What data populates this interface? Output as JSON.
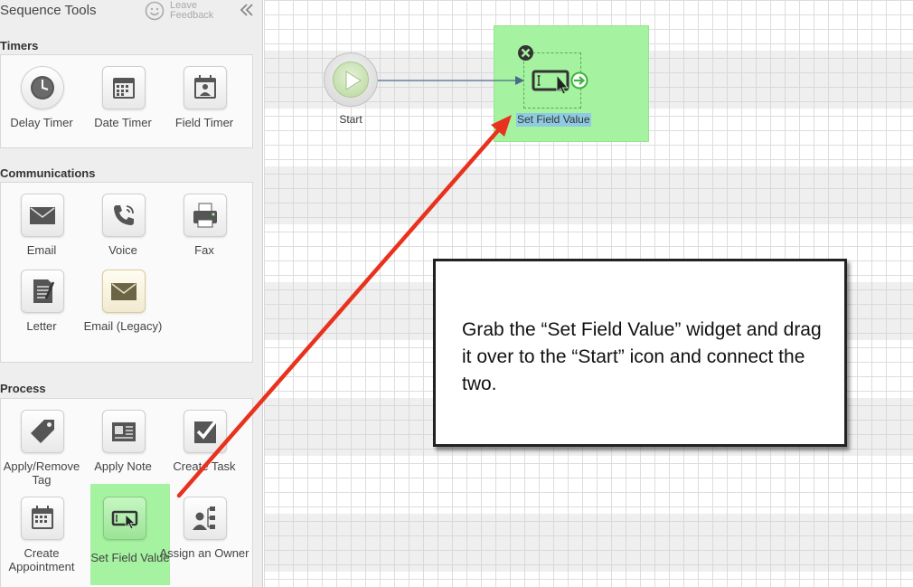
{
  "sidebar": {
    "title": "Sequence Tools",
    "feedback_label": "Leave Feedback",
    "sections": {
      "timers": {
        "title": "Timers",
        "items": [
          {
            "label": "Delay Timer",
            "icon": "clock-icon"
          },
          {
            "label": "Date Timer",
            "icon": "calendar-grid-icon"
          },
          {
            "label": "Field Timer",
            "icon": "calendar-person-icon"
          }
        ]
      },
      "communications": {
        "title": "Communications",
        "items": [
          {
            "label": "Email",
            "icon": "envelope-icon"
          },
          {
            "label": "Voice",
            "icon": "phone-icon"
          },
          {
            "label": "Fax",
            "icon": "fax-icon"
          },
          {
            "label": "Letter",
            "icon": "letter-icon"
          },
          {
            "label": "Email (Legacy)",
            "icon": "legacy-envelope-icon"
          }
        ]
      },
      "process": {
        "title": "Process",
        "items": [
          {
            "label": "Apply/Remove Tag",
            "icon": "tag-icon"
          },
          {
            "label": "Apply Note",
            "icon": "note-card-icon"
          },
          {
            "label": "Create Task",
            "icon": "checkbox-icon"
          },
          {
            "label": "Create Appointment",
            "icon": "appointment-icon"
          },
          {
            "label": "Set Field Value",
            "icon": "set-field-icon",
            "highlighted": true
          },
          {
            "label": "Assign an Owner",
            "icon": "owner-org-icon"
          }
        ]
      }
    }
  },
  "canvas": {
    "start_label": "Start",
    "node_label": "Set Field Value"
  },
  "callout": {
    "text": "Grab the “Set Field Value” widget and drag it over to the “Start” icon and connect the two."
  },
  "colors": {
    "highlight": "#a5f2a0",
    "arrow": "#e8321e",
    "connector": "#4a6b8a"
  }
}
